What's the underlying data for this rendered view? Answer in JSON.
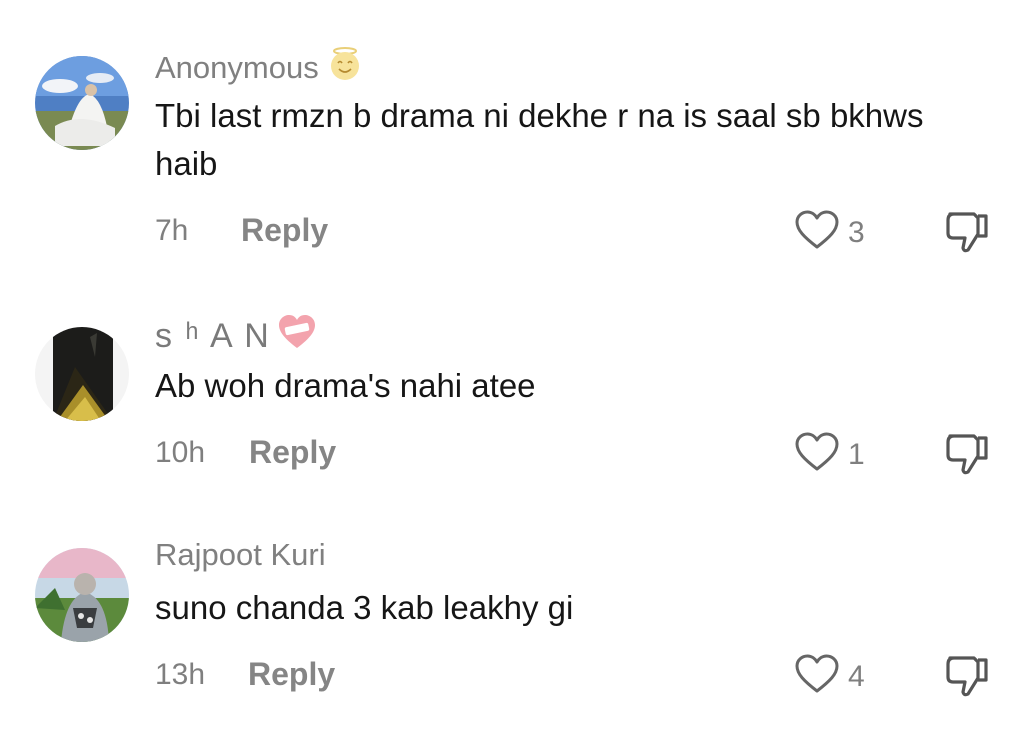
{
  "comments": [
    {
      "username": "Anonymous",
      "username_icon": "angel-emoji-icon",
      "text": "Tbi last rmzn b drama ni dekhe r na is saal sb bkhws haib",
      "time": "7h",
      "reply_label": "Reply",
      "likes": "3"
    },
    {
      "username": "s ʰ A N",
      "username_icon": "heart-bandage-emoji-icon",
      "text": "Ab woh drama's nahi atee",
      "time": "10h",
      "reply_label": "Reply",
      "likes": "1"
    },
    {
      "username": "Rajpoot Kuri",
      "username_icon": "",
      "text": "suno chanda 3 kab leakhy gi",
      "time": "13h",
      "reply_label": "Reply",
      "likes": "4"
    }
  ],
  "icons": {
    "like": "heart-outline-icon",
    "dislike": "thumbs-down-icon"
  },
  "colors": {
    "text_primary": "#161616",
    "text_secondary": "#808080"
  }
}
